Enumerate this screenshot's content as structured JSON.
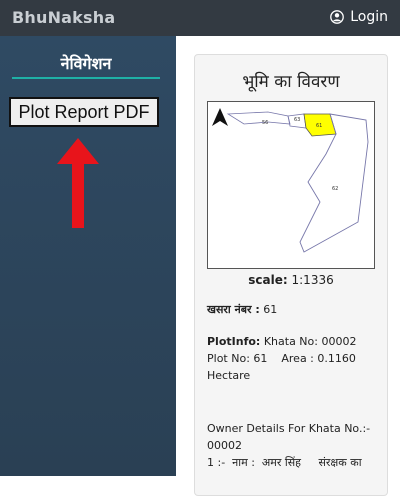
{
  "header": {
    "brand": "BhuNaksha",
    "login_label": "Login"
  },
  "sidebar": {
    "title": "नेविगेशन",
    "plot_report_button": "Plot Report PDF"
  },
  "details": {
    "title": "भूमि का विवरण",
    "map_labels": {
      "plot_main": "61",
      "plot_adj_1": "63",
      "plot_adj_2": "56",
      "plot_large": "62"
    },
    "scale_label": "scale:",
    "scale_value": "1:1336",
    "khasra_label": "खसरा नंबर :",
    "khasra_value": "61",
    "plotinfo_label": "PlotInfo:",
    "plotinfo_khata": "Khata No: 00002",
    "plotinfo_plot_area": "Plot No: 61    Area : 0.1160",
    "plotinfo_unit": "Hectare",
    "owner_heading": "Owner Details For Khata No.:-",
    "owner_khata": "00002",
    "owner_line": "1 :-  नाम :  अमर सिंह     संरक्षक का"
  },
  "colors": {
    "topbar": "#333a42",
    "sidebar": "#2f4a63",
    "accent_line": "#1fb0a6",
    "arrow": "#e8141b",
    "plot_highlight": "#ffff00"
  }
}
